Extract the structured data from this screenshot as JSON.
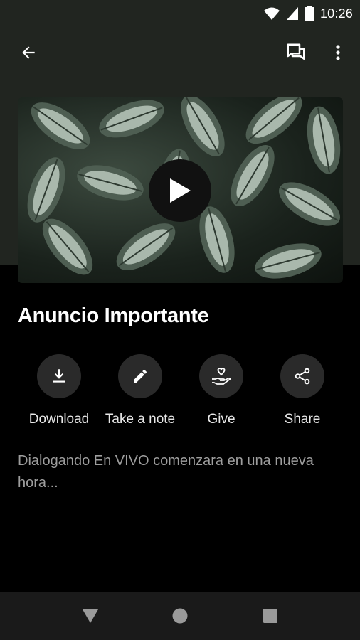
{
  "status_bar": {
    "time": "10:26"
  },
  "app_bar": {
    "back_icon": "arrow-left-icon",
    "chat_icon": "forum-icon",
    "menu_icon": "more-vert-icon"
  },
  "hero": {
    "play_icon": "play-icon"
  },
  "content": {
    "title": "Anuncio Importante",
    "actions": [
      {
        "label": "Download",
        "icon": "download-icon"
      },
      {
        "label": "Take a note",
        "icon": "pencil-icon"
      },
      {
        "label": "Give",
        "icon": "give-heart-hand-icon"
      },
      {
        "label": "Share",
        "icon": "share-icon"
      }
    ],
    "description": "Dialogando En VIVO comenzara en una nueva hora..."
  },
  "nav_bar": {
    "back_icon": "triangle-back-icon",
    "home_icon": "circle-home-icon",
    "recents_icon": "square-recents-icon"
  },
  "colors": {
    "header_bg": "#212520",
    "body_bg": "#000000",
    "action_circle": "#2a2a2a",
    "description_text": "#9e9e9e"
  }
}
